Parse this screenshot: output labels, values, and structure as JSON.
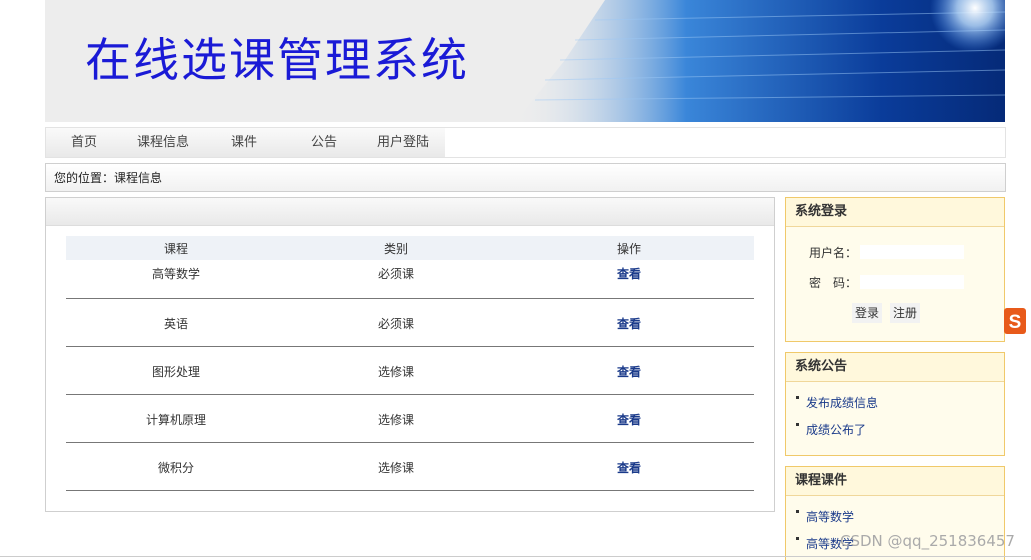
{
  "banner": {
    "title": "在线选课管理系统"
  },
  "nav": {
    "items": [
      {
        "label": "首页"
      },
      {
        "label": "课程信息"
      },
      {
        "label": "课件"
      },
      {
        "label": "公告"
      },
      {
        "label": "用户登陆"
      }
    ]
  },
  "breadcrumb": {
    "text": "您的位置：课程信息"
  },
  "table": {
    "headers": [
      "课程",
      "类别",
      "操作"
    ],
    "rows": [
      {
        "course": "高等数学",
        "type": "必须课",
        "action": "查看"
      },
      {
        "course": "英语",
        "type": "必须课",
        "action": "查看"
      },
      {
        "course": "图形处理",
        "type": "选修课",
        "action": "查看"
      },
      {
        "course": "计算机原理",
        "type": "选修课",
        "action": "查看"
      },
      {
        "course": "微积分",
        "type": "选修课",
        "action": "查看"
      }
    ]
  },
  "login": {
    "title": "系统登录",
    "username_label": "用户名：",
    "password_label": "密　码：",
    "username_value": "",
    "password_value": "",
    "login_button": "登录",
    "register_button": "注册"
  },
  "notices": {
    "title": "系统公告",
    "items": [
      "发布成绩信息",
      "成绩公布了"
    ]
  },
  "courseware": {
    "title": "课程课件",
    "items": [
      "高等数学",
      "高等数学"
    ]
  },
  "watermark": "CSDN @qq_251836457",
  "colors": {
    "title": "#1a1ad6",
    "link": "#1a3a8a",
    "sidebar_border": "#f0c96a"
  }
}
